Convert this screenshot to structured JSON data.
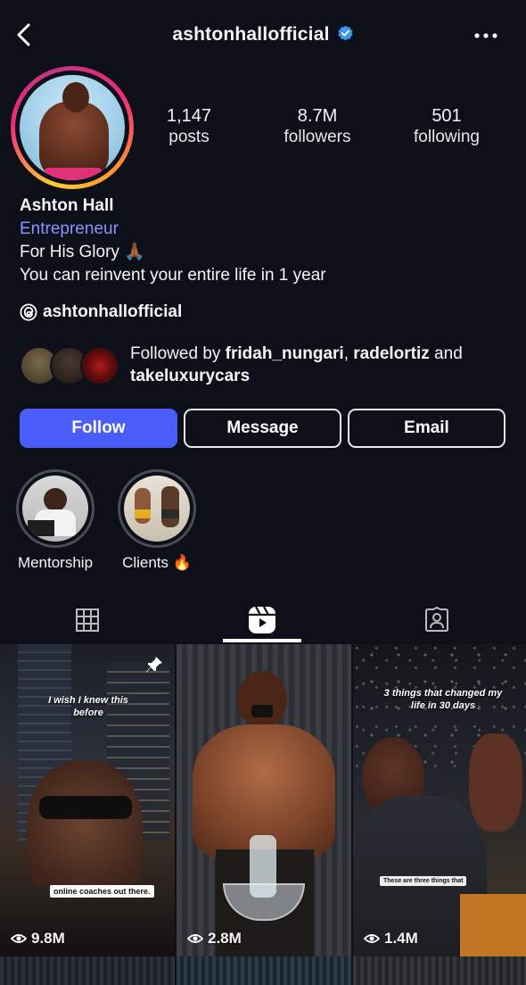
{
  "header": {
    "username": "ashtonhallofficial",
    "verified_icon": "verified-badge-icon",
    "back_icon": "chevron-left-icon",
    "more_icon": "more-horizontal-icon"
  },
  "profile": {
    "stats": [
      {
        "value": "1,147",
        "label": "posts"
      },
      {
        "value": "8.7M",
        "label": "followers"
      },
      {
        "value": "501",
        "label": "following"
      }
    ],
    "name": "Ashton Hall",
    "category": "Entrepreneur",
    "bio_line1": "For His Glory 🙏🏾",
    "bio_line2": "You can reinvent your entire life in 1 year",
    "threads_handle": "ashtonhallofficial",
    "followed_by": {
      "prefix": "Followed by ",
      "user1": "fridah_nungari",
      "sep": ", ",
      "user2": "radelortiz",
      "and": " and ",
      "user3": "takeluxurycars"
    }
  },
  "actions": {
    "follow": "Follow",
    "message": "Message",
    "email": "Email"
  },
  "highlights": [
    {
      "label": "Mentorship"
    },
    {
      "label": "Clients 🔥"
    }
  ],
  "tabs": [
    {
      "name": "grid",
      "icon": "grid-icon"
    },
    {
      "name": "reels",
      "icon": "reels-icon",
      "active": true
    },
    {
      "name": "tagged",
      "icon": "tagged-person-icon"
    }
  ],
  "reels": [
    {
      "views": "9.8M",
      "pinned": true,
      "overlay": "I wish I knew this before",
      "caption": "online coaches out there."
    },
    {
      "views": "2.8M",
      "pinned": false,
      "overlay": "",
      "caption": ""
    },
    {
      "views": "1.4M",
      "pinned": false,
      "overlay": "3 things that changed my life in 30 days",
      "caption": "These are three things that"
    }
  ],
  "colors": {
    "background": "#0d1018",
    "follow_button": "#4a5df9",
    "category_text": "#8b93ff",
    "verified": "#3897f0"
  }
}
